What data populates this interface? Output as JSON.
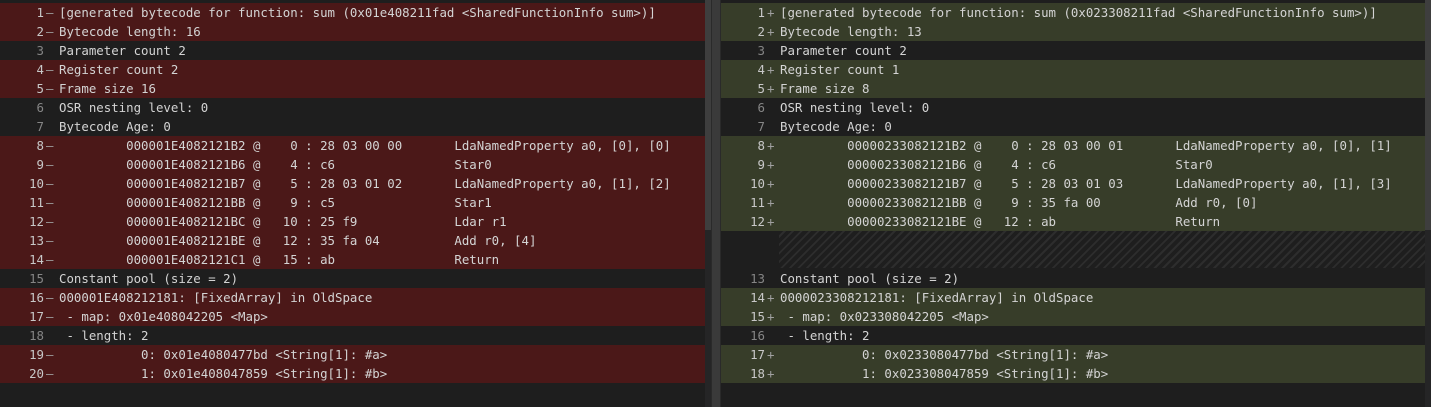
{
  "left": {
    "lines": [
      {
        "n": "1",
        "m": "—",
        "t": "[generated bytecode for function: sum (0x01e408211fad <SharedFunctionInfo sum>)]",
        "k": "rm"
      },
      {
        "n": "2",
        "m": "—",
        "t": "Bytecode length: 16",
        "k": "rm"
      },
      {
        "n": "3",
        "m": "",
        "t": "Parameter count 2",
        "k": "ctx"
      },
      {
        "n": "4",
        "m": "—",
        "t": "Register count 2",
        "k": "rm"
      },
      {
        "n": "5",
        "m": "—",
        "t": "Frame size 16",
        "k": "rm"
      },
      {
        "n": "6",
        "m": "",
        "t": "OSR nesting level: 0",
        "k": "ctx"
      },
      {
        "n": "7",
        "m": "",
        "t": "Bytecode Age: 0",
        "k": "ctx"
      },
      {
        "n": "8",
        "m": "—",
        "t": "         000001E4082121B2 @    0 : 28 03 00 00       LdaNamedProperty a0, [0], [0]",
        "k": "rm"
      },
      {
        "n": "9",
        "m": "—",
        "t": "         000001E4082121B6 @    4 : c6                Star0",
        "k": "rm"
      },
      {
        "n": "10",
        "m": "—",
        "t": "         000001E4082121B7 @    5 : 28 03 01 02       LdaNamedProperty a0, [1], [2]",
        "k": "rm"
      },
      {
        "n": "11",
        "m": "—",
        "t": "         000001E4082121BB @    9 : c5                Star1",
        "k": "rm"
      },
      {
        "n": "12",
        "m": "—",
        "t": "         000001E4082121BC @   10 : 25 f9             Ldar r1",
        "k": "rm"
      },
      {
        "n": "13",
        "m": "—",
        "t": "         000001E4082121BE @   12 : 35 fa 04          Add r0, [4]",
        "k": "rm"
      },
      {
        "n": "14",
        "m": "—",
        "t": "         000001E4082121C1 @   15 : ab                Return",
        "k": "rm"
      },
      {
        "n": "15",
        "m": "",
        "t": "Constant pool (size = 2)",
        "k": "ctx"
      },
      {
        "n": "16",
        "m": "—",
        "t": "000001E408212181: [FixedArray] in OldSpace",
        "k": "rm"
      },
      {
        "n": "17",
        "m": "—",
        "t": " - map: 0x01e408042205 <Map>",
        "k": "rm"
      },
      {
        "n": "18",
        "m": "",
        "t": " - length: 2",
        "k": "ctx"
      },
      {
        "n": "19",
        "m": "—",
        "t": "           0: 0x01e4080477bd <String[1]: #a>",
        "k": "rm"
      },
      {
        "n": "20",
        "m": "—",
        "t": "           1: 0x01e408047859 <String[1]: #b>",
        "k": "rm"
      }
    ]
  },
  "right": {
    "lines": [
      {
        "n": "1",
        "m": "+",
        "t": "[generated bytecode for function: sum (0x023308211fad <SharedFunctionInfo sum>)]",
        "k": "add"
      },
      {
        "n": "2",
        "m": "+",
        "t": "Bytecode length: 13",
        "k": "add"
      },
      {
        "n": "3",
        "m": "",
        "t": "Parameter count 2",
        "k": "ctx"
      },
      {
        "n": "4",
        "m": "+",
        "t": "Register count 1",
        "k": "add"
      },
      {
        "n": "5",
        "m": "+",
        "t": "Frame size 8",
        "k": "add"
      },
      {
        "n": "6",
        "m": "",
        "t": "OSR nesting level: 0",
        "k": "ctx"
      },
      {
        "n": "7",
        "m": "",
        "t": "Bytecode Age: 0",
        "k": "ctx"
      },
      {
        "n": "8",
        "m": "+",
        "t": "         00000233082121B2 @    0 : 28 03 00 01       LdaNamedProperty a0, [0], [1]",
        "k": "add"
      },
      {
        "n": "9",
        "m": "+",
        "t": "         00000233082121B6 @    4 : c6                Star0",
        "k": "add"
      },
      {
        "n": "10",
        "m": "+",
        "t": "         00000233082121B7 @    5 : 28 03 01 03       LdaNamedProperty a0, [1], [3]",
        "k": "add"
      },
      {
        "n": "11",
        "m": "+",
        "t": "         00000233082121BB @    9 : 35 fa 00          Add r0, [0]",
        "k": "add"
      },
      {
        "n": "12",
        "m": "+",
        "t": "         00000233082121BE @   12 : ab                Return",
        "k": "add"
      },
      {
        "n": "",
        "m": "",
        "t": "",
        "k": "gap"
      },
      {
        "n": "",
        "m": "",
        "t": "",
        "k": "gap"
      },
      {
        "n": "13",
        "m": "",
        "t": "Constant pool (size = 2)",
        "k": "ctx"
      },
      {
        "n": "14",
        "m": "+",
        "t": "0000023308212181: [FixedArray] in OldSpace",
        "k": "add"
      },
      {
        "n": "15",
        "m": "+",
        "t": " - map: 0x023308042205 <Map>",
        "k": "add"
      },
      {
        "n": "16",
        "m": "",
        "t": " - length: 2",
        "k": "ctx"
      },
      {
        "n": "17",
        "m": "+",
        "t": "           0: 0x0233080477bd <String[1]: #a>",
        "k": "add"
      },
      {
        "n": "18",
        "m": "+",
        "t": "           1: 0x023308047859 <String[1]: #b>",
        "k": "add"
      }
    ]
  }
}
